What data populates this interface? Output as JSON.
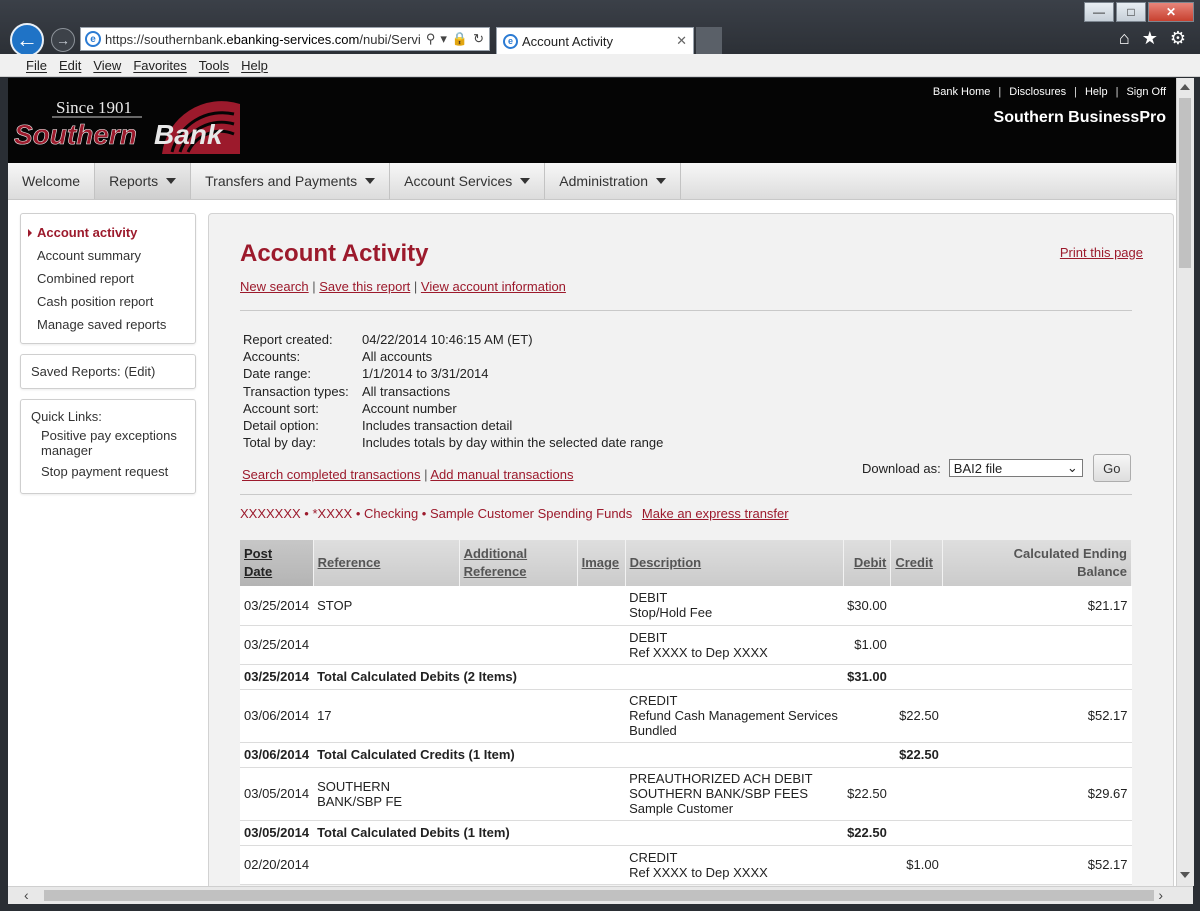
{
  "browser": {
    "url_prefix": "https://southernbank.",
    "url_domain": "ebanking-services.com",
    "url_suffix": "/nubi/Services",
    "tab_title": "Account Activity",
    "menu": [
      "File",
      "Edit",
      "View",
      "Favorites",
      "Tools",
      "Help"
    ]
  },
  "header": {
    "logo_since": "Since 1901",
    "logo_name_a": "Southern",
    "logo_name_b": "Bank",
    "top_links": [
      "Bank Home",
      "Disclosures",
      "Help",
      "Sign Off"
    ],
    "product_name": "Southern BusinessPro"
  },
  "nav": [
    "Welcome",
    "Reports",
    "Transfers and Payments",
    "Account Services",
    "Administration"
  ],
  "sidebar": {
    "items": [
      "Account activity",
      "Account summary",
      "Combined report",
      "Cash position report",
      "Manage saved reports"
    ],
    "saved_reports": "Saved Reports: (Edit)",
    "quick_links_label": "Quick Links:",
    "quick_links": [
      "Positive pay exceptions manager",
      "Stop payment request"
    ]
  },
  "main": {
    "title": "Account Activity",
    "print_link": "Print this page",
    "sub_links": [
      "New search",
      "Save this report",
      "View account information"
    ],
    "report_info": [
      {
        "k": "Report created:",
        "v": "04/22/2014 10:46:15 AM (ET)"
      },
      {
        "k": "Accounts:",
        "v": "All accounts"
      },
      {
        "k": "Date range:",
        "v": "1/1/2014 to 3/31/2014"
      },
      {
        "k": "Transaction types:",
        "v": "All transactions"
      },
      {
        "k": "Account sort:",
        "v": "Account number"
      },
      {
        "k": "Detail option:",
        "v": "Includes transaction detail"
      },
      {
        "k": "Total by day:",
        "v": "Includes totals by day within the selected date range"
      }
    ],
    "action_links": [
      "Search completed transactions",
      "Add manual transactions"
    ],
    "download_label": "Download as:",
    "download_value": "BAI2 file",
    "go_label": "Go",
    "account_line": "XXXXXXX • *XXXX • Checking • Sample Customer Spending Funds",
    "express_transfer": "Make an express transfer"
  },
  "table": {
    "headers": [
      "Post\nDate",
      "Reference",
      "Additional\nReference",
      "Image",
      "Description",
      "Debit",
      "Credit",
      "Calculated Ending\nBalance"
    ],
    "rows": [
      {
        "type": "row",
        "date": "03/25/2014",
        "ref": "STOP",
        "addref": "",
        "image": "",
        "desc": "DEBIT\nStop/Hold Fee",
        "debit": "$30.00",
        "credit": "",
        "balance": "$21.17"
      },
      {
        "type": "row",
        "date": "03/25/2014",
        "ref": "",
        "addref": "",
        "image": "",
        "desc": "DEBIT\nRef XXXX to Dep XXXX",
        "debit": "$1.00",
        "credit": "",
        "balance": ""
      },
      {
        "type": "total",
        "date": "03/25/2014",
        "label": "Total Calculated Debits (2 Items)",
        "debit": "$31.00",
        "credit": ""
      },
      {
        "type": "row",
        "date": "03/06/2014",
        "ref": "17",
        "addref": "",
        "image": "",
        "desc": "CREDIT\nRefund Cash Management Services\nBundled",
        "debit": "",
        "credit": "$22.50",
        "balance": "$52.17"
      },
      {
        "type": "total",
        "date": "03/06/2014",
        "label": "Total Calculated Credits (1 Item)",
        "debit": "",
        "credit": "$22.50"
      },
      {
        "type": "row",
        "date": "03/05/2014",
        "ref": "SOUTHERN\nBANK/SBP FE",
        "addref": "",
        "image": "",
        "desc": "PREAUTHORIZED ACH DEBIT\nSOUTHERN BANK/SBP FEES\nSample Customer",
        "debit": "$22.50",
        "credit": "",
        "balance": "$29.67"
      },
      {
        "type": "total",
        "date": "03/05/2014",
        "label": "Total Calculated Debits (1 Item)",
        "debit": "$22.50",
        "credit": ""
      },
      {
        "type": "row",
        "date": "02/20/2014",
        "ref": "",
        "addref": "",
        "image": "",
        "desc": "CREDIT\nRef XXXX to Dep XXXX",
        "debit": "",
        "credit": "$1.00",
        "balance": "$52.17"
      }
    ]
  },
  "colors": {
    "brand": "#9c1a2c",
    "header_bg": "#050505"
  }
}
